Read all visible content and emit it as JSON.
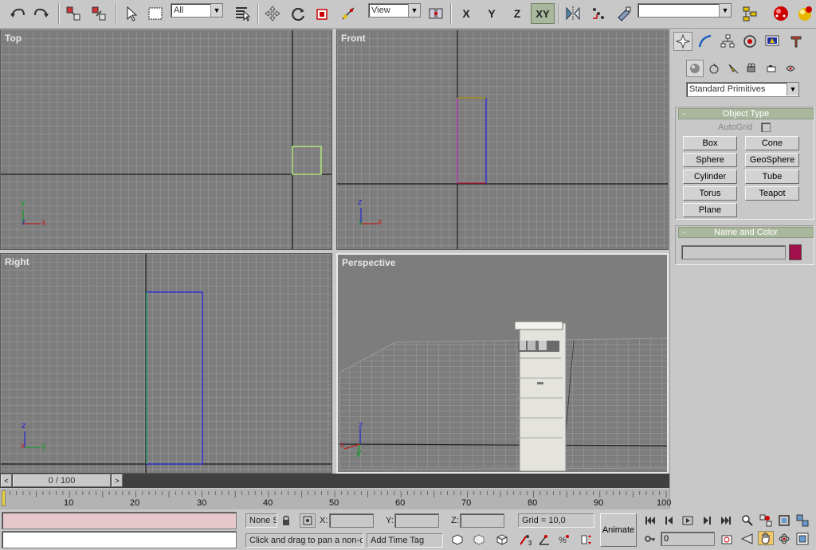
{
  "toolbar": {
    "selection_filter": "All",
    "coord_system": "View",
    "named_selection": "",
    "axis_x": "X",
    "axis_y": "Y",
    "axis_z": "Z",
    "axis_xy": "XY",
    "icons": [
      "undo-icon",
      "redo-icon",
      "link-icon",
      "unlink-icon",
      "select-icon",
      "rect-region-icon",
      "select-by-name-icon",
      "move-icon",
      "rotate-icon",
      "scale-icon",
      "pivot-icon",
      "mirror-icon",
      "array-icon",
      "material-editor-icon",
      "render-scene-icon",
      "quick-render-icon"
    ]
  },
  "viewports": {
    "top": {
      "label": "Top",
      "axis_v": "y",
      "axis_h": "x",
      "axis_o": "z"
    },
    "front": {
      "label": "Front",
      "axis_v": "z",
      "axis_h": "x",
      "axis_o": "y"
    },
    "right": {
      "label": "Right",
      "axis_v": "z",
      "axis_h": "y",
      "axis_o": "x"
    },
    "perspective": {
      "label": "Perspective",
      "axis_v": "z",
      "axis_h": "y",
      "axis_o": "x"
    }
  },
  "command_panel": {
    "category": "Standard Primitives",
    "object_type_title": "Object Type",
    "autogrid_label": "AutoGrid",
    "buttons": [
      "Box",
      "Cone",
      "Sphere",
      "GeoSphere",
      "Cylinder",
      "Tube",
      "Torus",
      "Teapot",
      "Plane"
    ],
    "name_color_title": "Name and Color",
    "object_name": "",
    "object_color": "#a0104a",
    "rollout_minus": "-"
  },
  "timeline": {
    "frame_display": "0 / 100",
    "ticks": [
      "10",
      "20",
      "30",
      "40",
      "50",
      "60",
      "70",
      "80",
      "90",
      "100"
    ]
  },
  "status": {
    "selection_text": "None S",
    "x_label": "X:",
    "y_label": "Y:",
    "z_label": "Z:",
    "x_value": "",
    "y_value": "",
    "z_value": "",
    "grid_text": "Grid = 10,0",
    "prompt_text": "Click and drag to pan a non-ca",
    "add_time_tag": "Add Time Tag",
    "animate_label": "Animate",
    "current_frame": "0",
    "accent": "#a9b89c"
  }
}
